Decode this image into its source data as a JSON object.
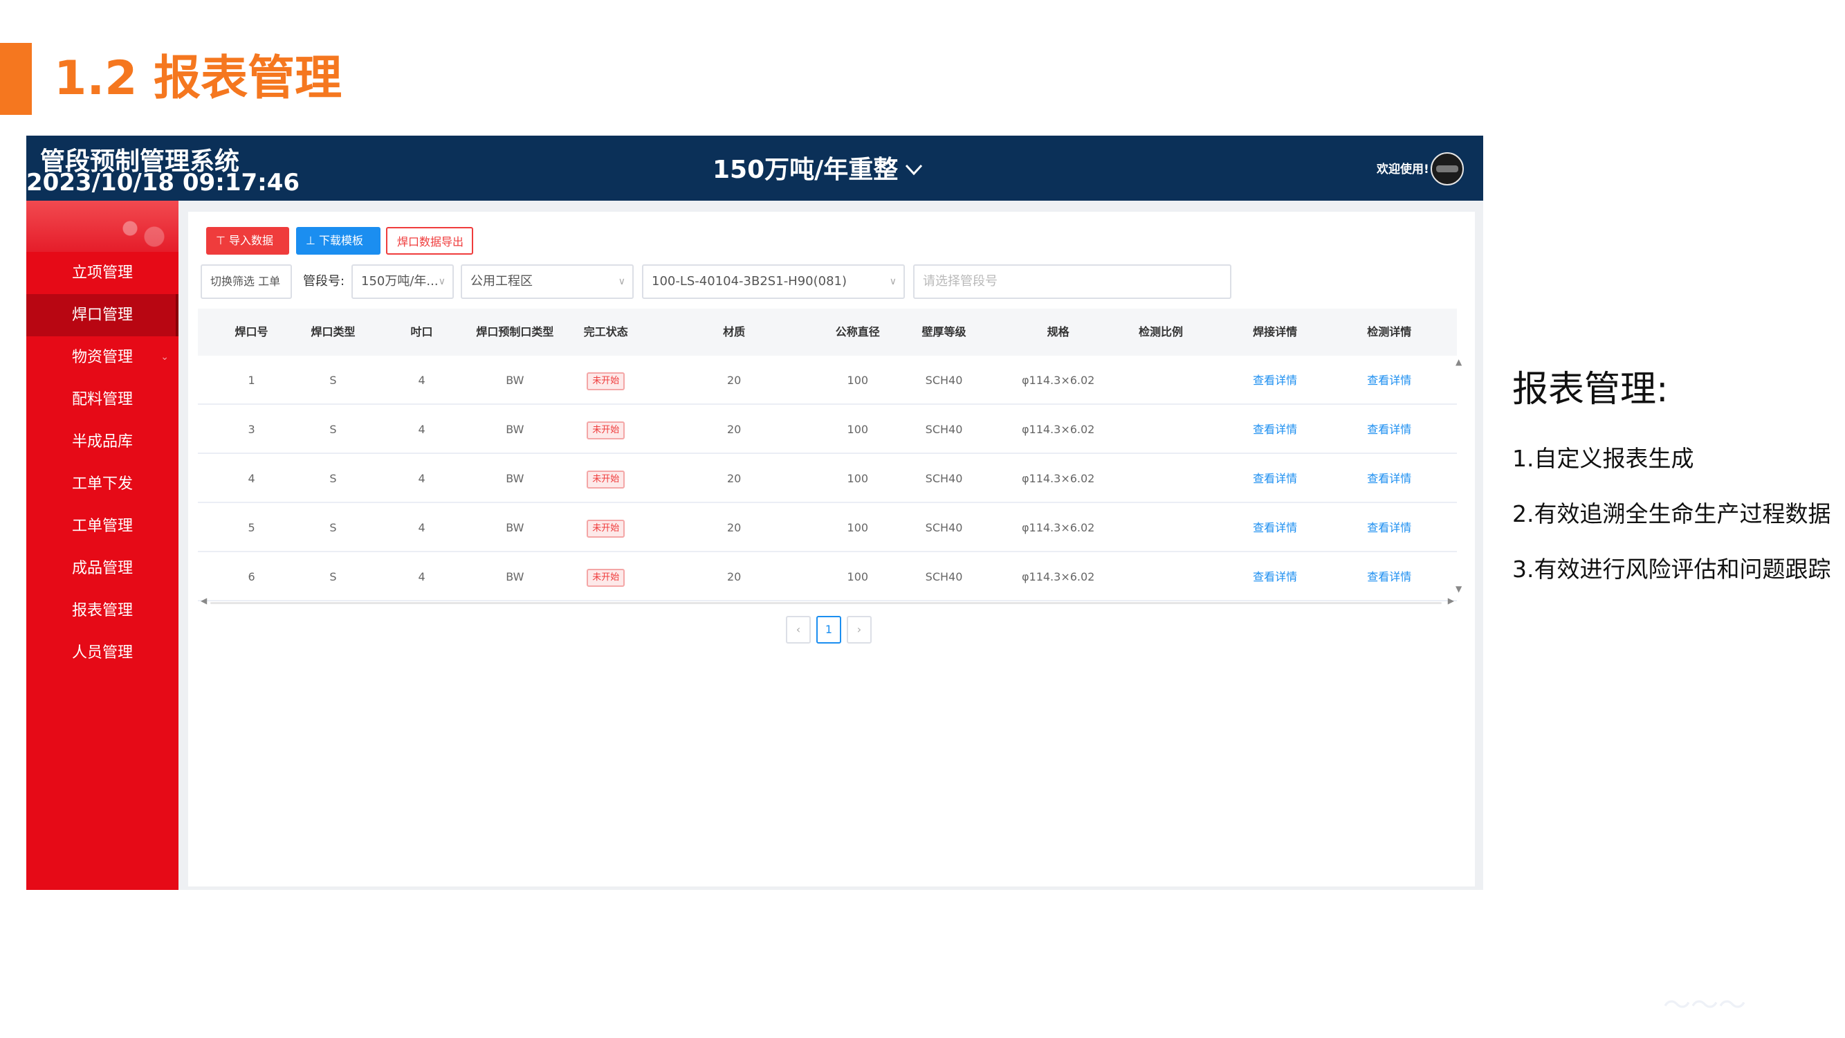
{
  "slide": {
    "title": "1.2 报表管理",
    "accent_color": "#f5771f"
  },
  "app": {
    "title": "管段预制管理系统",
    "datetime": "2023/10/18 09:17:46",
    "project": "150万吨/年重整",
    "project_chevron": "chevron-down-icon",
    "welcome": "欢迎使用!",
    "topbar_color": "#0b3058",
    "sidebar_color": "#e60a17"
  },
  "sidebar": {
    "items": [
      {
        "label": "立项管理",
        "active": false
      },
      {
        "label": "焊口管理",
        "active": true
      },
      {
        "label": "物资管理",
        "active": false,
        "has_submenu": true
      },
      {
        "label": "配料管理",
        "active": false
      },
      {
        "label": "半成品库",
        "active": false
      },
      {
        "label": "工单下发",
        "active": false
      },
      {
        "label": "工单管理",
        "active": false
      },
      {
        "label": "成品管理",
        "active": false
      },
      {
        "label": "报表管理",
        "active": false
      },
      {
        "label": "人员管理",
        "active": false
      }
    ]
  },
  "toolbar": {
    "import_label": "导入数据",
    "template_label": "下载模板",
    "export_label": "焊口数据导出",
    "import_icon": "upload-icon",
    "template_icon": "download-icon"
  },
  "filters": {
    "toggle_label": "切换筛选 工单",
    "pipe_label": "管段号:",
    "project_value": "150万吨/年...",
    "area_value": "公用工程区",
    "line_value": "100-LS-40104-3B2S1-H90(081)",
    "segment_placeholder": "请选择管段号"
  },
  "table": {
    "columns": [
      "焊口号",
      "焊口类型",
      "吋口",
      "焊口预制口类型",
      "完工状态",
      "材质",
      "公称直径",
      "壁厚等级",
      "规格",
      "检测比例",
      "焊接详情",
      "检测详情"
    ],
    "rows": [
      [
        "1",
        "S",
        "4",
        "BW",
        "未开始",
        "20",
        "100",
        "SCH40",
        "φ114.3×6.02",
        "",
        "查看详情",
        "查看详情"
      ],
      [
        "3",
        "S",
        "4",
        "BW",
        "未开始",
        "20",
        "100",
        "SCH40",
        "φ114.3×6.02",
        "",
        "查看详情",
        "查看详情"
      ],
      [
        "4",
        "S",
        "4",
        "BW",
        "未开始",
        "20",
        "100",
        "SCH40",
        "φ114.3×6.02",
        "",
        "查看详情",
        "查看详情"
      ],
      [
        "5",
        "S",
        "4",
        "BW",
        "未开始",
        "20",
        "100",
        "SCH40",
        "φ114.3×6.02",
        "",
        "查看详情",
        "查看详情"
      ],
      [
        "6",
        "S",
        "4",
        "BW",
        "未开始",
        "20",
        "100",
        "SCH40",
        "φ114.3×6.02",
        "",
        "查看详情",
        "查看详情"
      ]
    ],
    "status_color": "#ef3c3c",
    "link_color": "#1b8ef0"
  },
  "pagination": {
    "prev_icon": "chevron-left-icon",
    "current_page": "1",
    "next_icon": "chevron-right-icon"
  },
  "notes": {
    "title": "报表管理:",
    "items": [
      "1.自定义报表生成",
      "2.有效追溯全生命生产过程数据",
      "3.有效进行风险评估和问题跟踪"
    ]
  }
}
